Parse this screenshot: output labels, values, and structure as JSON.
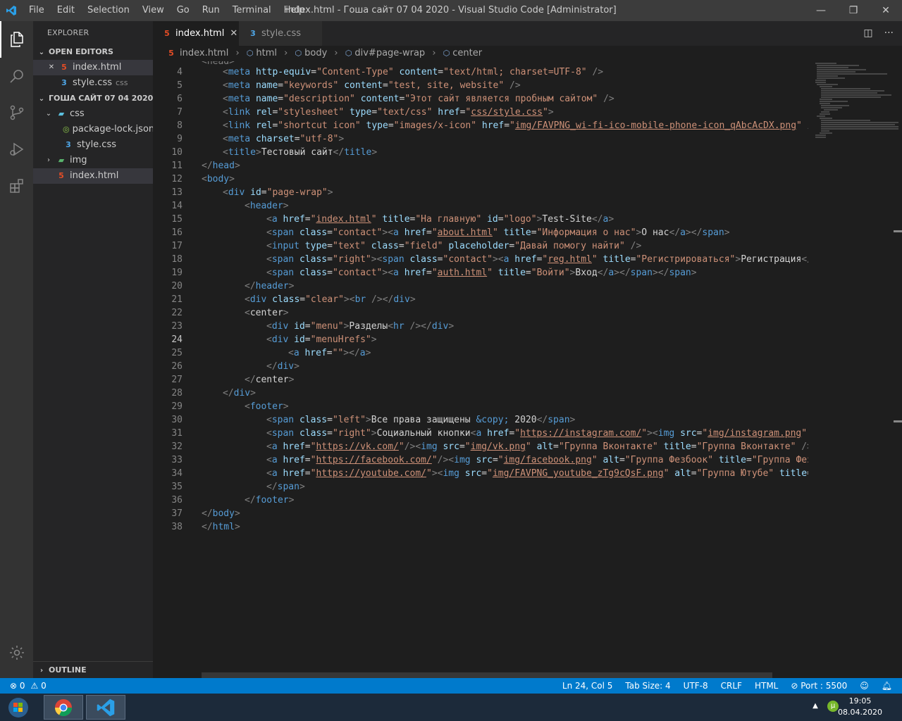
{
  "window": {
    "title": "index.html - Гоша сайт 07 04 2020 - Visual Studio Code [Administrator]",
    "menu": [
      "File",
      "Edit",
      "Selection",
      "View",
      "Go",
      "Run",
      "Terminal",
      "Help"
    ],
    "controls": {
      "minimize": "—",
      "restore": "❐",
      "close": "✕"
    }
  },
  "activity_bar": [
    "explorer-icon",
    "search-icon",
    "source-control-icon",
    "run-debug-icon",
    "extensions-icon",
    "gear-icon"
  ],
  "sidebar": {
    "title": "EXPLORER",
    "open_editors_label": "OPEN EDITORS",
    "open_editors": [
      {
        "name": "index.html",
        "type": "html",
        "selected": true
      },
      {
        "name": "style.css",
        "type": "css",
        "folder": "css"
      }
    ],
    "folder_label": "ГОША САЙТ 07 04 2020",
    "tree": [
      {
        "name": "css",
        "type": "folder",
        "expanded": true
      },
      {
        "name": "package-lock.json",
        "type": "json"
      },
      {
        "name": "style.css",
        "type": "css"
      },
      {
        "name": "img",
        "type": "img-folder",
        "expanded": false
      },
      {
        "name": "index.html",
        "type": "html",
        "selected": true
      }
    ],
    "outline_label": "OUTLINE"
  },
  "tabs": [
    {
      "label": "index.html",
      "active": true,
      "close": "✕"
    },
    {
      "label": "style.css",
      "active": false
    }
  ],
  "breadcrumb": [
    "index.html",
    "html",
    "body",
    "div#page-wrap",
    "center"
  ],
  "editor": {
    "first_line_partial": "<head>",
    "lines": [
      {
        "n": "4"
      },
      {
        "n": "5"
      },
      {
        "n": "6"
      },
      {
        "n": "7"
      },
      {
        "n": "8"
      },
      {
        "n": "9"
      },
      {
        "n": "10"
      },
      {
        "n": "11"
      },
      {
        "n": "12"
      },
      {
        "n": "13"
      },
      {
        "n": "14"
      },
      {
        "n": "15"
      },
      {
        "n": "16"
      },
      {
        "n": "17"
      },
      {
        "n": "18"
      },
      {
        "n": "19"
      },
      {
        "n": "20"
      },
      {
        "n": "21"
      },
      {
        "n": "22"
      },
      {
        "n": "23"
      },
      {
        "n": "24"
      },
      {
        "n": "25"
      },
      {
        "n": "26"
      },
      {
        "n": "27"
      },
      {
        "n": "28"
      },
      {
        "n": "29"
      },
      {
        "n": "30"
      },
      {
        "n": "31"
      },
      {
        "n": "32"
      },
      {
        "n": "33"
      },
      {
        "n": "34"
      },
      {
        "n": "35"
      },
      {
        "n": "36"
      },
      {
        "n": "37"
      },
      {
        "n": "38"
      }
    ]
  },
  "status_bar": {
    "errors": "⊗ 0",
    "warnings": "⚠ 0",
    "position": "Ln 24, Col 5",
    "tab_size": "Tab Size: 4",
    "encoding": "UTF-8",
    "eol": "CRLF",
    "language": "HTML",
    "port": "⊘ Port : 5500",
    "feedback_icon": "feedback-icon",
    "bell_icon": "bell-icon"
  },
  "taskbar": {
    "time": "19:05",
    "date": "08.04.2020"
  },
  "colors": {
    "status_bar": "#007acc",
    "editor_bg": "#1e1e1e",
    "sidebar_bg": "#252526",
    "activity_bg": "#333333",
    "tag": "#569cd6",
    "attribute": "#9cdcfe",
    "string": "#ce9178"
  }
}
